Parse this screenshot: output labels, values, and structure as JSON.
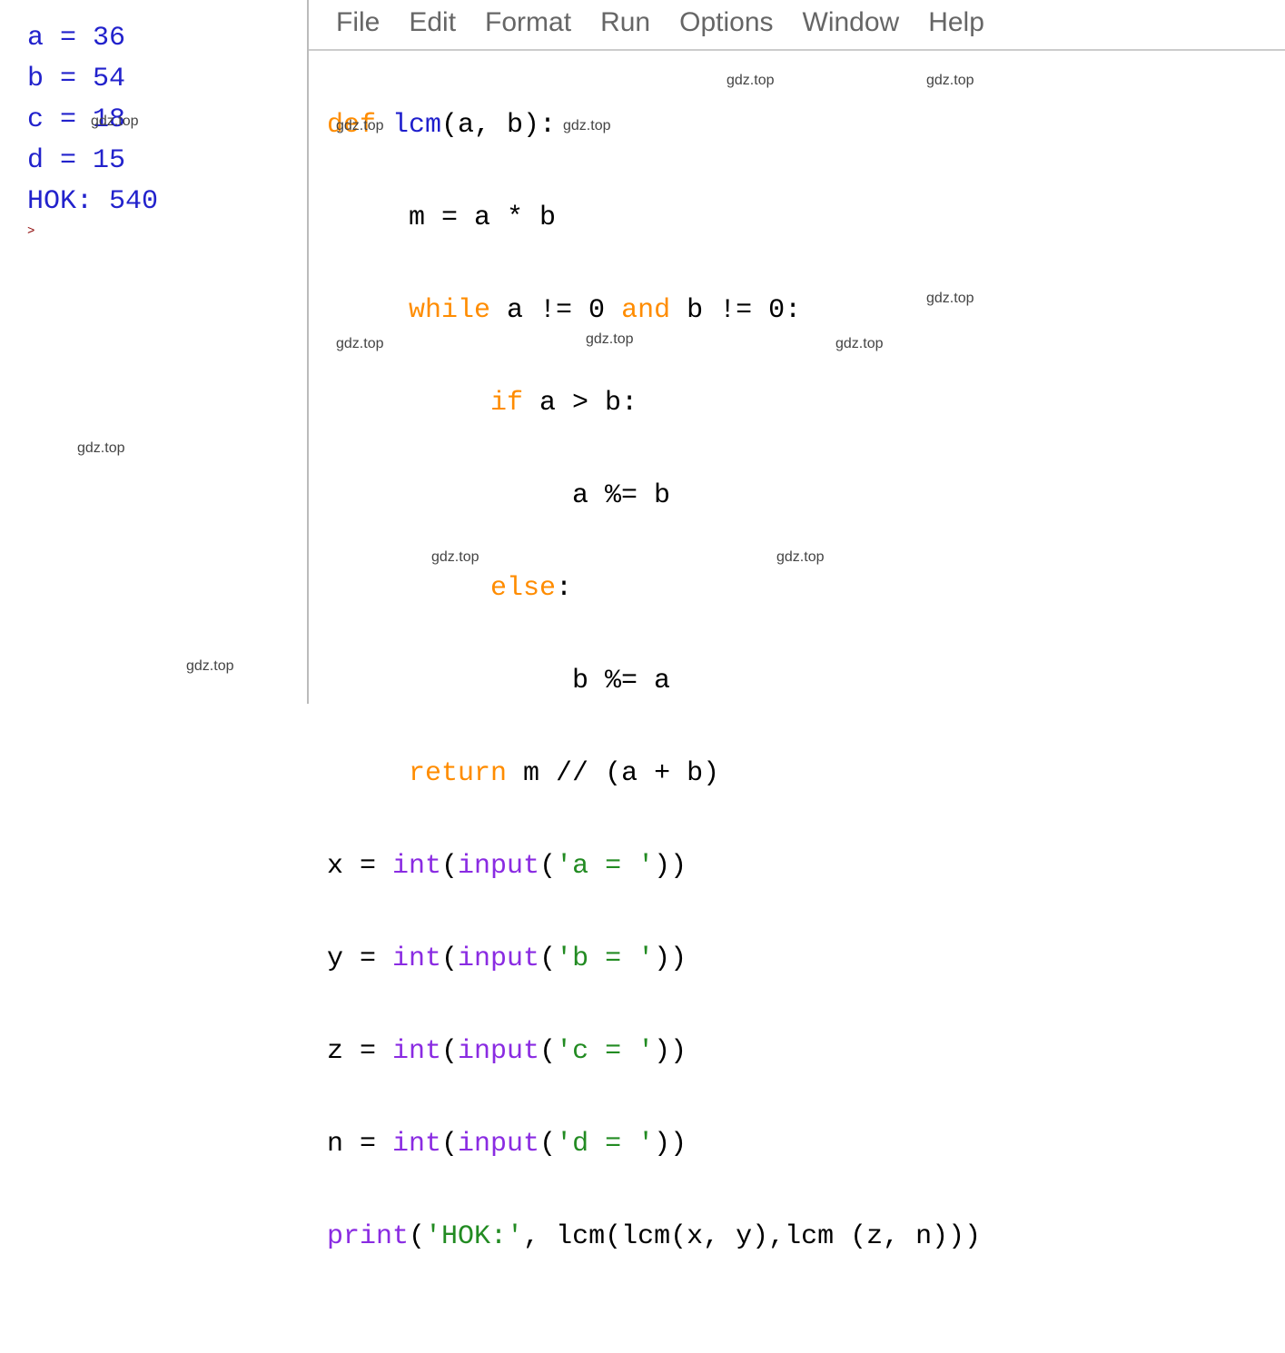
{
  "shell": {
    "lines": [
      "a = 36",
      "b = 54",
      "c = 18",
      "d = 15",
      "HOK: 540"
    ],
    "prompt": ">"
  },
  "menu": {
    "file": "File",
    "edit": "Edit",
    "format": "Format",
    "run": "Run",
    "options": "Options",
    "window": "Window",
    "help": "Help"
  },
  "code": {
    "l1": {
      "def": "def",
      "fn": " lcm",
      "rest": "(a, b):"
    },
    "l2": {
      "indent": "     ",
      "txt": "m = a * b"
    },
    "l3": {
      "indent": "     ",
      "kw1": "while",
      "mid": " a != 0 ",
      "kw2": "and",
      "end": " b != 0:"
    },
    "l4": {
      "indent": "          ",
      "kw": "if",
      "rest": " a > b:"
    },
    "l5": {
      "indent": "               ",
      "txt": "a %= b"
    },
    "l6": {
      "indent": "          ",
      "kw": "else",
      "rest": ":"
    },
    "l7": {
      "indent": "               ",
      "txt": "b %= a"
    },
    "l8": {
      "indent": "     ",
      "kw": "return",
      "rest": " m // (a + b)"
    },
    "l9": {
      "pre": "x = ",
      "bi1": "int",
      "op1": "(",
      "bi2": "input",
      "op2": "(",
      "str": "'a = '",
      "end": "))"
    },
    "l10": {
      "pre": "y = ",
      "bi1": "int",
      "op1": "(",
      "bi2": "input",
      "op2": "(",
      "str": "'b = '",
      "end": "))"
    },
    "l11": {
      "pre": "z = ",
      "bi1": "int",
      "op1": "(",
      "bi2": "input",
      "op2": "(",
      "str": "'c = '",
      "end": "))"
    },
    "l12": {
      "pre": "n = ",
      "bi1": "int",
      "op1": "(",
      "bi2": "input",
      "op2": "(",
      "str": "'d = '",
      "end": "))"
    },
    "l13": {
      "bi": "print",
      "op1": "(",
      "str": "'HOK:'",
      "rest": ", lcm(lcm(x, y),lcm (z, n)))"
    }
  },
  "watermark": "gdz.top"
}
